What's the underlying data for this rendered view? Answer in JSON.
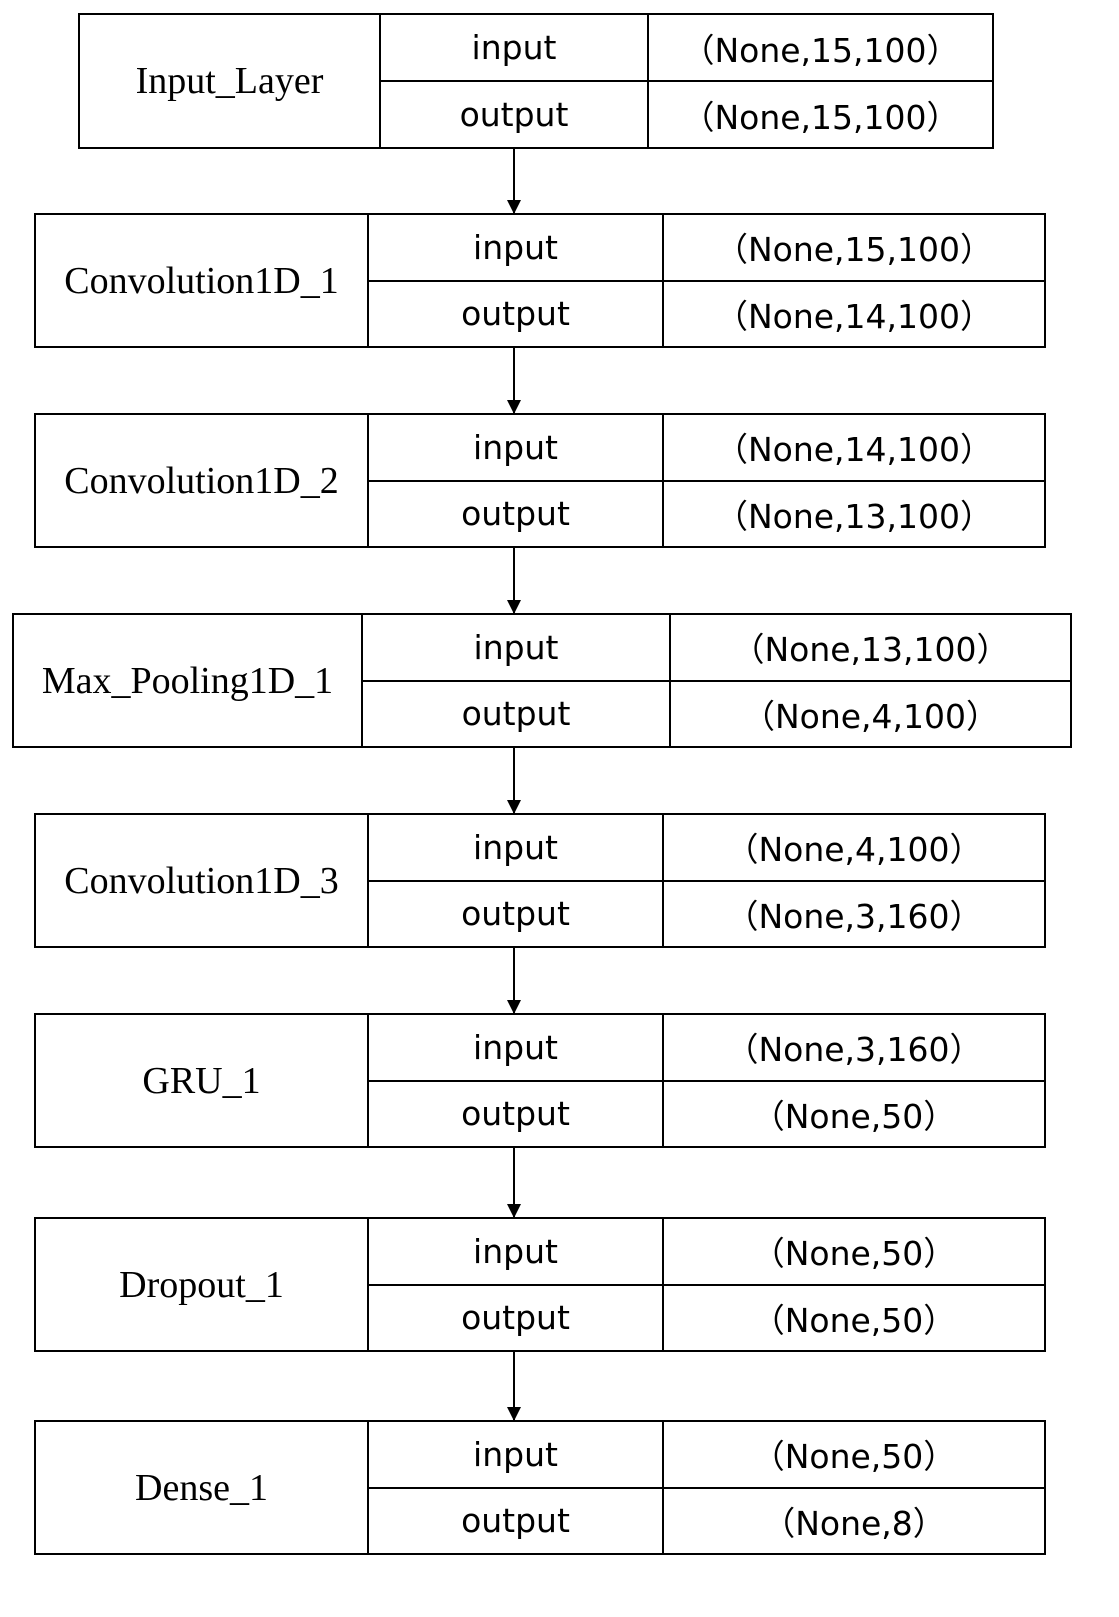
{
  "diagram": {
    "type": "model-architecture",
    "row_labels": {
      "input": "input",
      "output": "output"
    },
    "layers": [
      {
        "name": "Input_Layer",
        "input": "（None,15,100）",
        "output": "（None,15,100）"
      },
      {
        "name": "Convolution1D_1",
        "input": "（None,15,100）",
        "output": "（None,14,100）"
      },
      {
        "name": "Convolution1D_2",
        "input": "（None,14,100）",
        "output": "（None,13,100）"
      },
      {
        "name": "Max_Pooling1D_1",
        "input": "（None,13,100）",
        "output": "（None,4,100）"
      },
      {
        "name": "Convolution1D_3",
        "input": "（None,4,100）",
        "output": "（None,3,160）"
      },
      {
        "name": "GRU_1",
        "input": "（None,3,160）",
        "output": "（None,50）"
      },
      {
        "name": "Dropout_1",
        "input": "（None,50）",
        "output": "（None,50）"
      },
      {
        "name": "Dense_1",
        "input": "（None,50）",
        "output": "（None,8）"
      }
    ],
    "edges": [
      {
        "from": "Input_Layer",
        "to": "Convolution1D_1"
      },
      {
        "from": "Convolution1D_1",
        "to": "Convolution1D_2"
      },
      {
        "from": "Convolution1D_2",
        "to": "Max_Pooling1D_1"
      },
      {
        "from": "Max_Pooling1D_1",
        "to": "Convolution1D_3"
      },
      {
        "from": "Convolution1D_3",
        "to": "GRU_1"
      },
      {
        "from": "GRU_1",
        "to": "Dropout_1"
      },
      {
        "from": "Dropout_1",
        "to": "Dense_1"
      }
    ]
  }
}
